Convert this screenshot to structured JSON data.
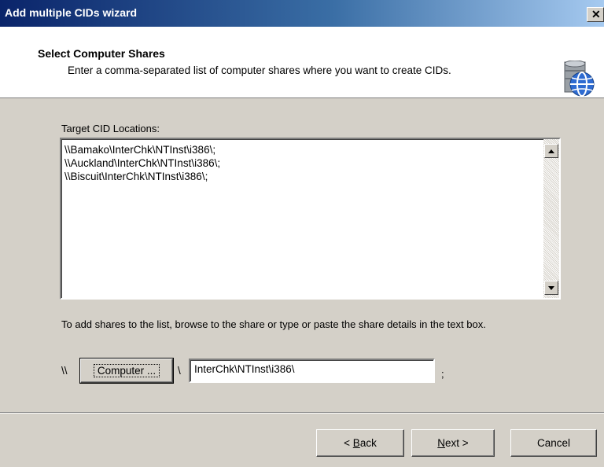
{
  "window": {
    "title": "Add multiple CIDs wizard",
    "close_glyph": "✕"
  },
  "header": {
    "title": "Select Computer Shares",
    "subtitle": "Enter a comma-separated list of computer shares where you want to create CIDs.",
    "icon": "network-globe-icon"
  },
  "main": {
    "target_label": "Target CID Locations:",
    "target_lines": [
      "\\\\Bamako\\InterChk\\NTInst\\i386\\;",
      "\\\\Auckland\\InterChk\\NTInst\\i386\\;",
      "\\\\Biscuit\\InterChk\\NTInst\\i386\\;"
    ],
    "hint": "To add shares to the list, browse to the share or type or paste the share details in the text box.",
    "prefix": "\\\\",
    "computer_button": "Computer ...",
    "separator": "\\",
    "share_path_value": "InterChk\\NTInst\\i386\\",
    "suffix": ";"
  },
  "footer": {
    "back_prefix": "< ",
    "back_key": "B",
    "back_rest": "ack",
    "next_key": "N",
    "next_rest": "ext >",
    "cancel": "Cancel"
  }
}
